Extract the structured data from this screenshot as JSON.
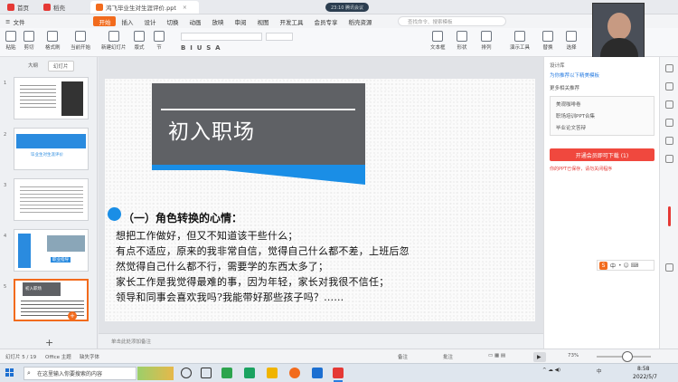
{
  "titlebar": {
    "tabs": [
      {
        "label": "首页",
        "color": "#e53935"
      },
      {
        "label": "稻壳",
        "color": "#e53935"
      },
      {
        "label": "鸿飞毕业生对生涯评价.ppt",
        "color": "#f26b1d"
      }
    ],
    "meeting": "23:10  腾讯会议"
  },
  "menubar": {
    "file": "文件",
    "items": [
      "开始",
      "插入",
      "设计",
      "切换",
      "动画",
      "放映",
      "审阅",
      "视图",
      "开发工具",
      "会员专享",
      "稻壳资源"
    ],
    "active": "开始",
    "search_placeholder": "查找命令、搜索模板"
  },
  "ribbon": {
    "buttons": [
      "粘贴",
      "剪切",
      "格式刷",
      "当前开始",
      "新建幻灯片",
      "版式",
      "节",
      "重置",
      "文本框",
      "形状",
      "排列",
      "轮廓",
      "演示工具",
      "替换",
      "选择"
    ]
  },
  "left_panel": {
    "view_tabs": [
      "大纲",
      "幻灯片"
    ],
    "active_view": "幻灯片",
    "thumbnails": [
      {
        "num": "1",
        "caption": ""
      },
      {
        "num": "2",
        "caption": "毕业生对生涯评价"
      },
      {
        "num": "3",
        "caption": ""
      },
      {
        "num": "4",
        "caption": "职业指导"
      },
      {
        "num": "5",
        "caption": "初入职场"
      }
    ],
    "add_label": "+"
  },
  "slide": {
    "title": "初入职场",
    "section_heading": "（一）角色转换的心情：",
    "lines": [
      "想把工作做好，但又不知道该干些什么；",
      "有点不适应，原来的我非常自信，觉得自己什么都不差，上班后忽",
      "然觉得自己什么都不行，需要学的东西太多了；",
      "家长工作是我觉得最难的事，因为年轻，家长对我很不信任；",
      "领导和同事会喜欢我吗?我能带好那些孩子吗？……"
    ],
    "accent_blue": "#1a8ee6",
    "title_bg": "#5f6165"
  },
  "notes_placeholder": "单击此处添加备注",
  "right_panel": {
    "header": "设计库",
    "recommend": "为你推荐以下精美模板",
    "related": "更多相关推荐",
    "box_lines": [
      "美观咖啡卷",
      "职场培训PPT合集",
      "毕业论文答辩"
    ],
    "download_label": "开通会员即可下载 (1)",
    "notice": "你的PPT已保存，请勿关闭程序"
  },
  "statusbar": {
    "slide_info": "幻灯片 5 / 19",
    "theme": "Office 主题",
    "missing_font": "缺失字体",
    "notes_toggle": "备注",
    "comments": "批注",
    "zoom": "73%"
  },
  "taskbar": {
    "search_placeholder": "在这里输入你要搜索的内容",
    "time": "8:58",
    "date": "2022/5/7",
    "tray_lang": "中"
  }
}
